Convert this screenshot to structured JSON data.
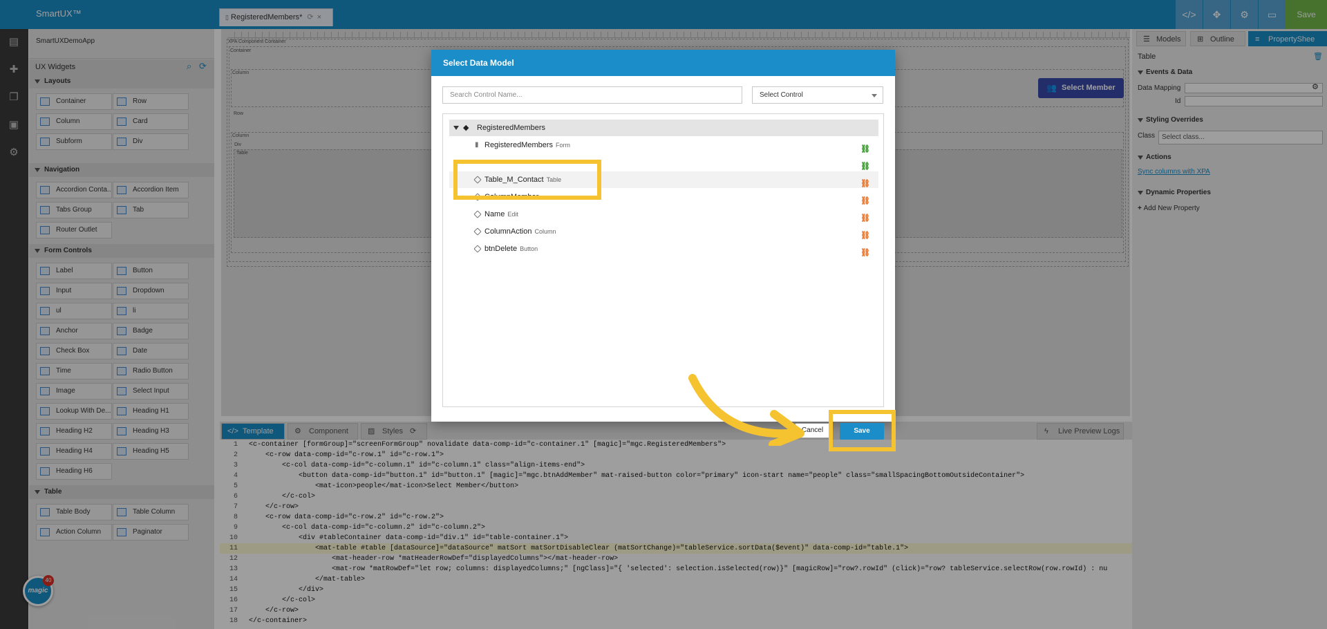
{
  "app": {
    "brand": "SmartUX™",
    "project": "SmartUXDemoApp"
  },
  "editor_tab": {
    "label": "RegisteredMembers",
    "modified_mark": "*"
  },
  "toolbar": {
    "code_icon": "code-icon",
    "expand_icon": "expand-icon",
    "network_icon": "network-icon",
    "monitor_icon": "monitor-icon",
    "save_label": "Save"
  },
  "widgets": {
    "title": "UX Widgets",
    "sections": [
      {
        "label": "Layouts",
        "items": [
          "Container",
          "Row",
          "Column",
          "Card",
          "Subform",
          "Div"
        ]
      },
      {
        "label": "Navigation",
        "items": [
          "Accordion Conta...",
          "Accordion Item",
          "Tabs Group",
          "Tab",
          "Router Outlet"
        ]
      },
      {
        "label": "Form Controls",
        "items": [
          "Label",
          "Button",
          "Input",
          "Dropdown",
          "ul",
          "li",
          "Anchor",
          "Badge",
          "Check Box",
          "Date",
          "Time",
          "Radio Button",
          "Image",
          "Select Input",
          "Lookup With De...",
          "Heading H1",
          "Heading H2",
          "Heading H3",
          "Heading H4",
          "Heading H5",
          "Heading H6"
        ]
      },
      {
        "label": "Table",
        "items": [
          "Table Body",
          "Table Column",
          "Action Column",
          "Paginator"
        ]
      }
    ]
  },
  "canvas": {
    "labels": [
      "XPA Component Container",
      "Container",
      "Column",
      "Row",
      "Column",
      "Div",
      "Table"
    ],
    "select_member_label": "Select Member"
  },
  "bottom_tabs": [
    "Template",
    "Component",
    "Styles",
    "Live Preview Logs"
  ],
  "code_lines": [
    "<c-container [formGroup]=\"screenFormGroup\" novalidate data-comp-id=\"c-container.1\" [magic]=\"mgc.RegisteredMembers\">",
    "    <c-row data-comp-id=\"c-row.1\" id=\"c-row.1\">",
    "        <c-col data-comp-id=\"c-column.1\" id=\"c-column.1\" class=\"align-items-end\">",
    "            <button data-comp-id=\"button.1\" id=\"button.1\" [magic]=\"mgc.btnAddMember\" mat-raised-button color=\"primary\" icon-start name=\"people\" class=\"smallSpacingBottomOutsideContainer\">",
    "                <mat-icon>people</mat-icon>Select Member</button>",
    "        </c-col>",
    "    </c-row>",
    "    <c-row data-comp-id=\"c-row.2\" id=\"c-row.2\">",
    "        <c-col data-comp-id=\"c-column.2\" id=\"c-column.2\">",
    "            <div #tableContainer data-comp-id=\"div.1\" id=\"table-container.1\">",
    "                <mat-table #table [dataSource]=\"dataSource\" matSort matSortDisableClear (matSortChange)=\"tableService.sortData($event)\" data-comp-id=\"table.1\">",
    "                    <mat-header-row *matHeaderRowDef=\"displayedColumns\"></mat-header-row>",
    "                    <mat-row *matRowDef=\"let row; columns: displayedColumns;\" [ngClass]=\"{ 'selected': selection.isSelected(row)}\" [magicRow]=\"row?.rowId\" (click)=\"row? tableService.selectRow(row.rowId) : nu",
    "                </mat-table>",
    "            </div>",
    "        </c-col>",
    "    </c-row>",
    "</c-container>"
  ],
  "properties": {
    "tabs": [
      "Models",
      "Outline",
      "PropertyShee"
    ],
    "selected": "Table",
    "events_section": "Events & Data",
    "data_mapping_label": "Data Mapping",
    "id_label": "Id",
    "styling_section": "Styling Overrides",
    "class_label": "Class",
    "class_placeholder": "Select class...",
    "actions_section": "Actions",
    "sync_link": "Sync columns with XPA",
    "dynamic_section": "Dynamic Properties",
    "add_property": "Add New Property"
  },
  "dialog": {
    "title": "Select Data Model",
    "search_placeholder": "Search Control Name...",
    "select_control": "Select Control",
    "root": "RegisteredMembers",
    "rows": [
      {
        "name": "RegisteredMembers",
        "type": "Form",
        "linked": true
      },
      {
        "name": "",
        "type": "",
        "linked": true
      },
      {
        "name": "Table_M_Contact",
        "type": "Table",
        "linked": false
      },
      {
        "name": "ColumnMember",
        "type": "",
        "linked": false
      },
      {
        "name": "Name",
        "type": "Edit",
        "linked": false
      },
      {
        "name": "ColumnAction",
        "type": "Column",
        "linked": false
      },
      {
        "name": "btnDelete",
        "type": "Button",
        "linked": false
      }
    ],
    "cancel_label": "Cancel",
    "save_label": "Save"
  },
  "colors": {
    "header_blue": "#1b8dc8",
    "save_green": "#72b84a",
    "highlight_yellow": "#f5c230",
    "link_green": "#3a9a2e",
    "unlink_orange": "#e8742a",
    "member_button": "#3949ab"
  },
  "magic_logo": {
    "text": "magic",
    "badge": "40"
  }
}
